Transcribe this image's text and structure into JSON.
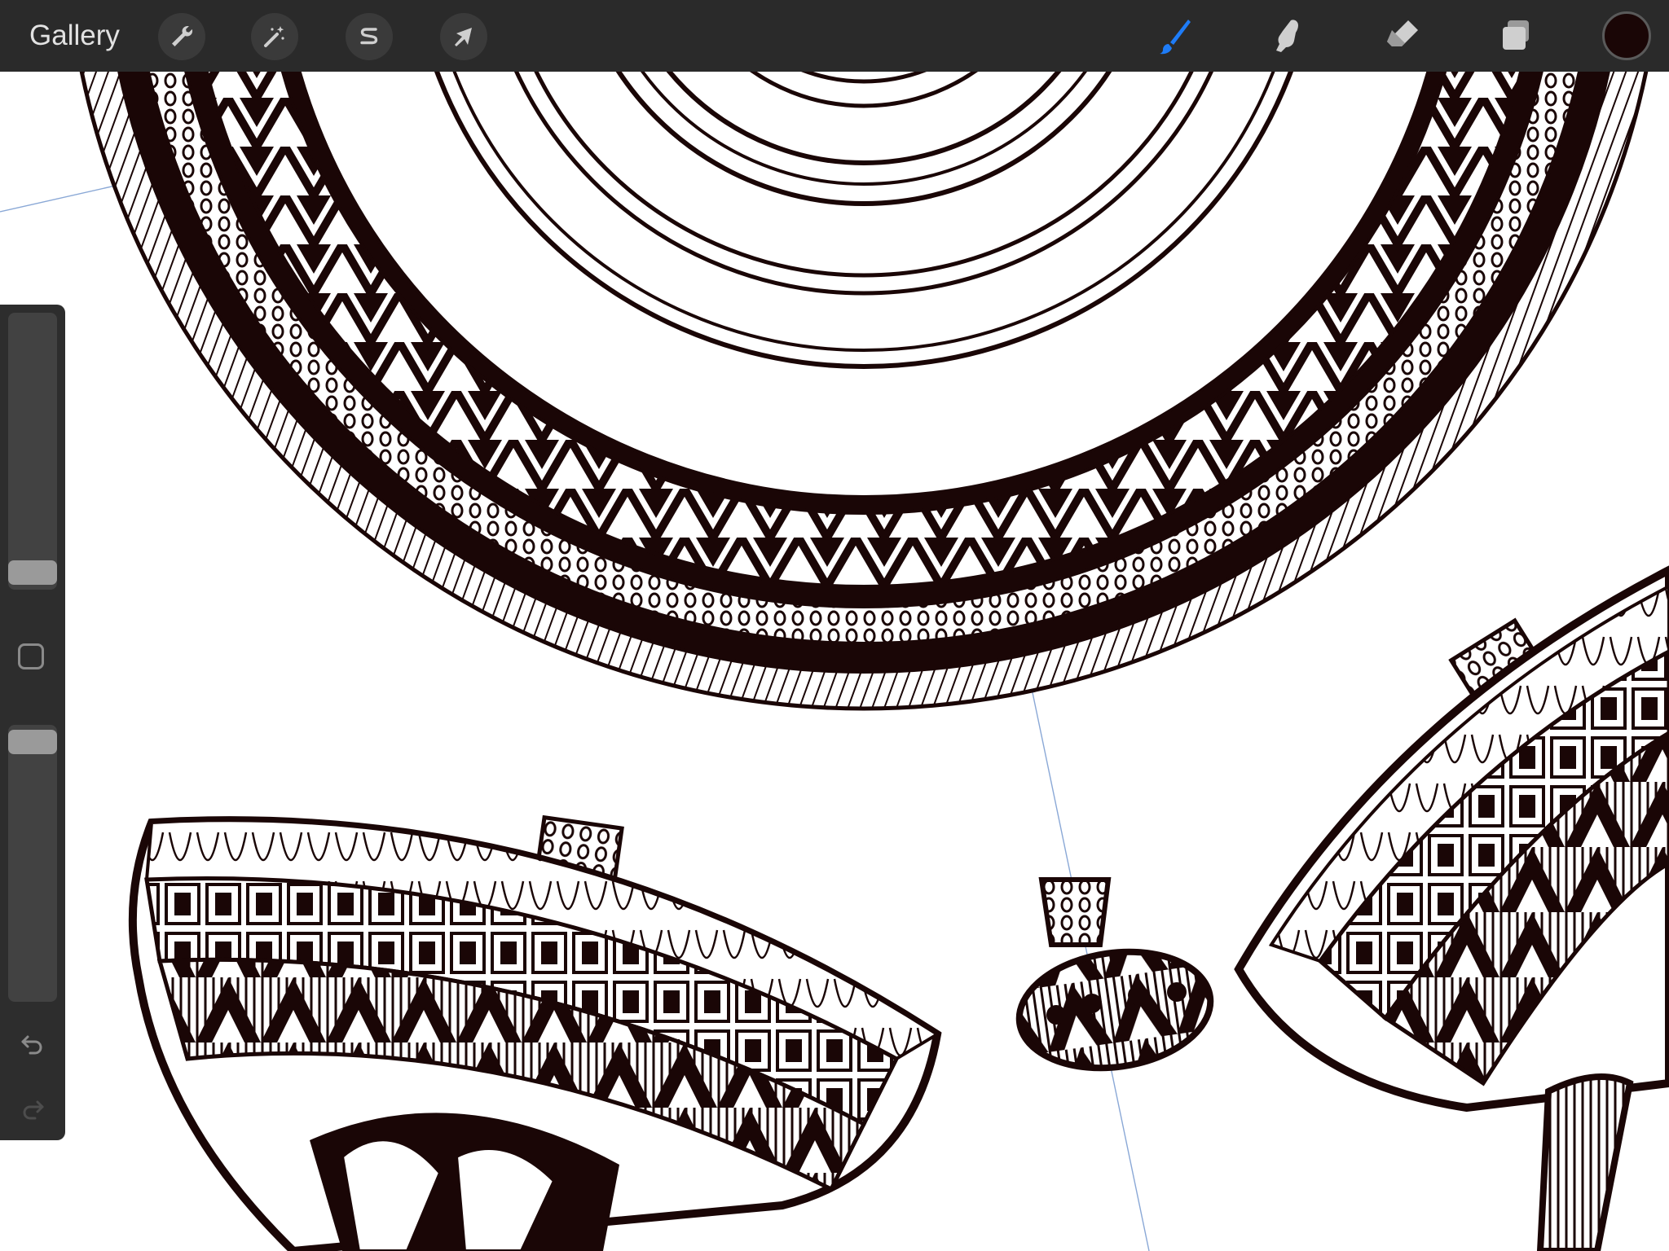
{
  "app": {
    "gallery_label": "Gallery"
  },
  "toolbar": {
    "left_tools": [
      {
        "name": "actions",
        "icon": "wrench-icon"
      },
      {
        "name": "adjustments",
        "icon": "magic-wand-icon"
      },
      {
        "name": "selection",
        "icon": "selection-s-icon"
      },
      {
        "name": "transform",
        "icon": "arrow-cursor-icon"
      }
    ],
    "right_tools": [
      {
        "name": "brush",
        "icon": "brush-icon",
        "active": true
      },
      {
        "name": "smudge",
        "icon": "smudge-finger-icon",
        "active": false
      },
      {
        "name": "eraser",
        "icon": "eraser-icon",
        "active": false
      },
      {
        "name": "layers",
        "icon": "layers-icon",
        "active": false
      }
    ],
    "current_color": "#1a0606",
    "active_color": "#1e7cf7"
  },
  "sidebar": {
    "brush_size_level": 0.02,
    "opacity_level": 0.98
  }
}
